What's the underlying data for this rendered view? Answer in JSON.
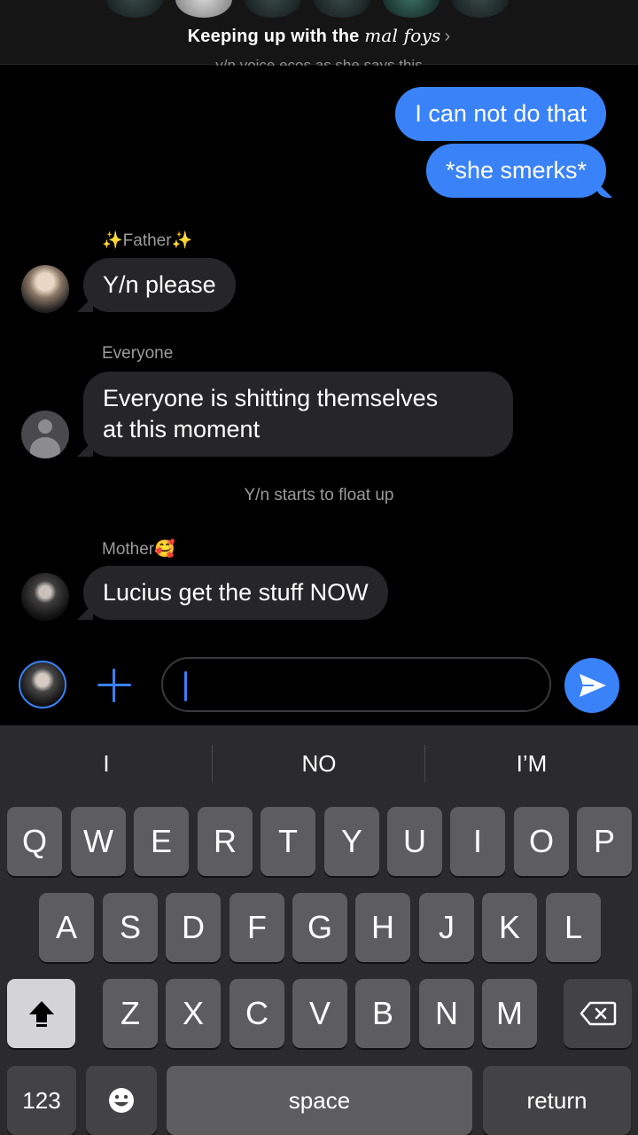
{
  "header": {
    "title_prefix": "Keeping up with the ",
    "title_italic": "mal foys",
    "chevron": "›",
    "cut_message": "y/n voice ecos as she says this"
  },
  "messages": {
    "outgoing_1": "I can not do that",
    "outgoing_2": "*she smerks*",
    "father_name": "✨Father✨",
    "father_msg": "Y/n please",
    "everyone_name": "Everyone",
    "everyone_msg_line1": "Everyone is shitting themselves",
    "everyone_msg_line2": "at this moment",
    "system_note": "Y/n starts to float up",
    "mother_name": "Mother🥰",
    "mother_msg": "Lucius get the stuff NOW"
  },
  "composer": {
    "value": "",
    "add_icon": "plus-icon",
    "send_icon": "send-icon"
  },
  "keyboard": {
    "suggestions": [
      "I",
      "NO",
      "I’M"
    ],
    "row1": [
      "Q",
      "W",
      "E",
      "R",
      "T",
      "Y",
      "U",
      "I",
      "O",
      "P"
    ],
    "row2": [
      "A",
      "S",
      "D",
      "F",
      "G",
      "H",
      "J",
      "K",
      "L"
    ],
    "row3": [
      "Z",
      "X",
      "C",
      "V",
      "B",
      "N",
      "M"
    ],
    "numbers_label": "123",
    "space_label": "space",
    "return_label": "return",
    "emoji_icon": "emoji-icon",
    "shift_icon": "shift-icon",
    "delete_icon": "delete-icon"
  },
  "colors": {
    "accent": "#3a82f7",
    "incoming_bubble": "#262629",
    "keyboard_bg": "#2b2b2d",
    "key": "#5d5d60"
  }
}
